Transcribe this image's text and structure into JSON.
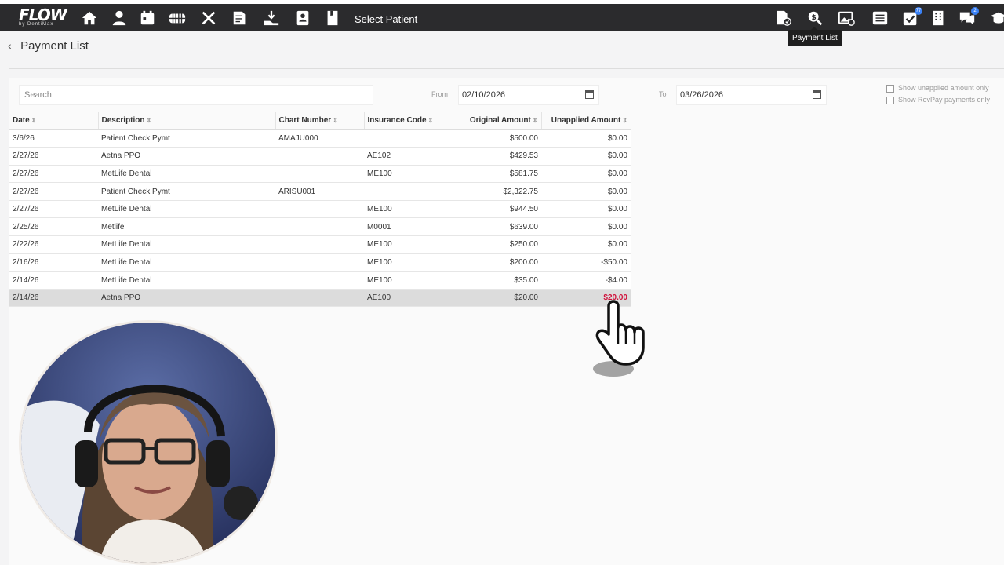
{
  "app": {
    "logo_text": "FLOW",
    "logo_sub": "by DentiMax",
    "select_patient": "Select Patient",
    "tooltip": "Payment List",
    "badges": {
      "tasks": "77",
      "messages": "2"
    }
  },
  "nav_icons": [
    "home-icon",
    "patient-icon",
    "calendar-icon",
    "chart-icon",
    "tools-icon",
    "ledger-icon",
    "payment-icon",
    "contacts-icon",
    "notes-icon"
  ],
  "right_icons": [
    "document-check-icon",
    "payment-search-icon",
    "image-icon",
    "list-icon",
    "tasks-icon",
    "building-icon",
    "chat-icon",
    "graduation-icon"
  ],
  "page": {
    "title": "Payment List"
  },
  "filters": {
    "search_placeholder": "Search",
    "from_label": "From",
    "from_value": "02/10/2026",
    "to_label": "To",
    "to_value": "03/26/2026",
    "show_unapplied": "Show unapplied amount only",
    "show_revpay": "Show RevPay payments only"
  },
  "table": {
    "headers": {
      "date": "Date",
      "description": "Description",
      "chart": "Chart Number",
      "insurance": "Insurance Code",
      "original": "Original Amount",
      "unapplied": "Unapplied Amount"
    },
    "rows": [
      {
        "date": "3/6/26",
        "description": "Patient Check Pymt",
        "chart": "AMAJU000",
        "insurance": "",
        "original": "$500.00",
        "unapplied": "$0.00"
      },
      {
        "date": "2/27/26",
        "description": "Aetna PPO",
        "chart": "",
        "insurance": "AE102",
        "original": "$429.53",
        "unapplied": "$0.00"
      },
      {
        "date": "2/27/26",
        "description": "MetLife Dental",
        "chart": "",
        "insurance": "ME100",
        "original": "$581.75",
        "unapplied": "$0.00"
      },
      {
        "date": "2/27/26",
        "description": "Patient Check Pymt",
        "chart": "ARISU001",
        "insurance": "",
        "original": "$2,322.75",
        "unapplied": "$0.00"
      },
      {
        "date": "2/27/26",
        "description": "MetLife Dental",
        "chart": "",
        "insurance": "ME100",
        "original": "$944.50",
        "unapplied": "$0.00"
      },
      {
        "date": "2/25/26",
        "description": "Metlife",
        "chart": "",
        "insurance": "M0001",
        "original": "$639.00",
        "unapplied": "$0.00"
      },
      {
        "date": "2/22/26",
        "description": "MetLife Dental",
        "chart": "",
        "insurance": "ME100",
        "original": "$250.00",
        "unapplied": "$0.00"
      },
      {
        "date": "2/16/26",
        "description": "MetLife Dental",
        "chart": "",
        "insurance": "ME100",
        "original": "$200.00",
        "unapplied": "-$50.00"
      },
      {
        "date": "2/14/26",
        "description": "MetLife Dental",
        "chart": "",
        "insurance": "ME100",
        "original": "$35.00",
        "unapplied": "-$4.00"
      },
      {
        "date": "2/14/26",
        "description": "Aetna PPO",
        "chart": "",
        "insurance": "AE100",
        "original": "$20.00",
        "unapplied": "$20.00"
      }
    ]
  },
  "colors": {
    "topbar": "#2b2b2d",
    "highlight": "#dcdcdc",
    "alert": "#d0103a"
  }
}
